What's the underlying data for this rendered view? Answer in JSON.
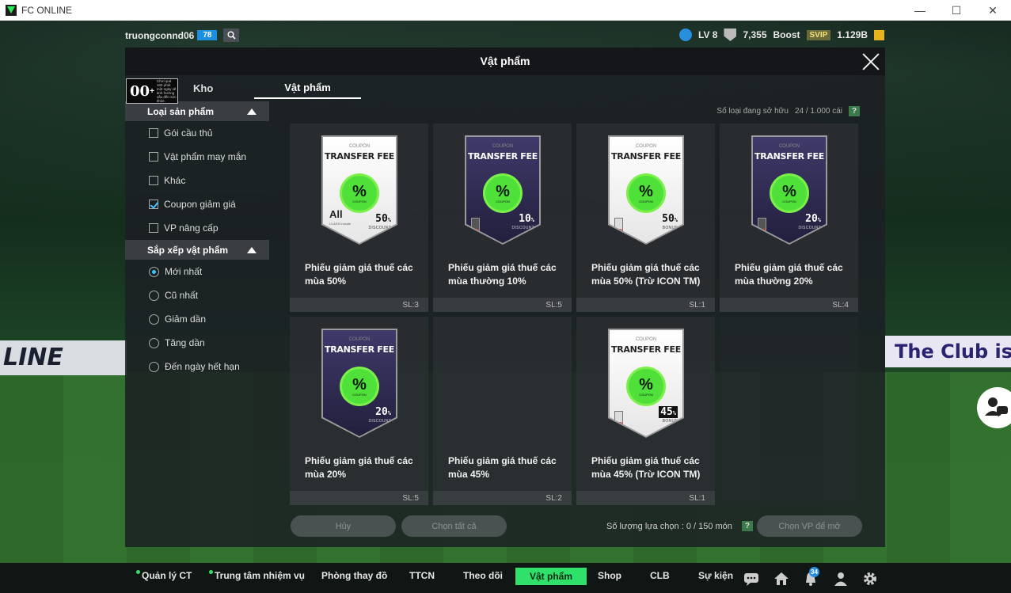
{
  "window": {
    "title": "FC ONLINE",
    "min": "—",
    "max": "☐",
    "close": "✕"
  },
  "background": {
    "ad_left": "LINE",
    "ad_right": "The Club is Y"
  },
  "hud": {
    "username": "truongconnd06",
    "user_level": "78",
    "level": "LV 8",
    "points": "7,355",
    "boost_label": "Boost",
    "svip": "SVIP",
    "coins": "1.129B"
  },
  "panel": {
    "title": "Vật phẩm",
    "tabs": [
      "Kho",
      "Vật phẩm"
    ],
    "age_rating": {
      "value": "00",
      "plus": "+",
      "note": "Chơi quá 180 phút một ngày sẽ ảnh hưởng xấu đến sức khỏe."
    },
    "owned_label": "Số loại đang sở hữu",
    "owned_value": "24 / 1.000 cái",
    "help": "?"
  },
  "sidebar": {
    "category_header": "Loại sản phẩm",
    "categories": [
      {
        "label": "Gói cầu thủ",
        "checked": false
      },
      {
        "label": "Vật phẩm may mắn",
        "checked": false
      },
      {
        "label": "Khác",
        "checked": false
      },
      {
        "label": "Coupon giảm giá",
        "checked": true
      },
      {
        "label": "VP nâng cấp",
        "checked": false
      }
    ],
    "sort_header": "Sắp xếp vật phẩm",
    "sorts": [
      {
        "label": "Mới nhất",
        "selected": true
      },
      {
        "label": "Cũ nhất",
        "selected": false
      },
      {
        "label": "Giảm dần",
        "selected": false
      },
      {
        "label": "Tăng dần",
        "selected": false
      },
      {
        "label": "Đến ngày hết hạn",
        "selected": false
      }
    ]
  },
  "coupon_common": {
    "coupon_word": "COUPON",
    "transfer_fee": "TRANSFER FEE",
    "pct": "%",
    "seal_text": "COUPON"
  },
  "items": [
    {
      "name": "Phiếu giảm giá thuế các mùa 50%",
      "qty": "SL:3",
      "style": "white",
      "value": "50",
      "value_unit": "%",
      "value_sub": "DISCOUNT",
      "all_label": "All",
      "all_sub": "CLASS Include"
    },
    {
      "name": "Phiếu giảm giá thuế các mùa thường 10%",
      "qty": "SL:5",
      "style": "dark",
      "value": "10",
      "value_unit": "%",
      "value_sub": "DISCOUNT"
    },
    {
      "name": "Phiếu giảm giá thuế các mùa 50% (Trừ ICON TM)",
      "qty": "SL:1",
      "style": "white",
      "value": "50",
      "value_unit": "%",
      "value_sub": "BONUS"
    },
    {
      "name": "Phiếu giảm giá thuế các mùa thường 20%",
      "qty": "SL:4",
      "style": "dark",
      "value": "20",
      "value_unit": "%",
      "value_sub": "DISCOUNT"
    },
    {
      "name": "Phiếu giảm giá thuế các mùa 20%",
      "qty": "SL:5",
      "style": "dark",
      "value": "20",
      "value_unit": "%",
      "value_sub": "DISCOUNT"
    },
    {
      "name": "Phiếu giảm giá thuế các mùa 45%",
      "qty": "SL:2",
      "style": "none"
    },
    {
      "name": "Phiếu giảm giá thuế các mùa 45% (Trừ ICON TM)",
      "qty": "SL:1",
      "style": "white",
      "value": "45",
      "value_unit": "%",
      "value_sub": "BONUS"
    }
  ],
  "footer": {
    "cancel": "Hủy",
    "select_all": "Chọn tất cả",
    "select_count_label": "Số lượng lựa chọn : 0 / 150 món",
    "choose_vp": "Chọn VP để mở"
  },
  "nav": {
    "items": [
      {
        "label": "Quản lý CT",
        "dot": true
      },
      {
        "label": "Trung tâm nhiệm vụ",
        "dot": true
      },
      {
        "label": "Phòng thay đồ"
      },
      {
        "label": "TTCN"
      },
      {
        "label": "Theo dõi"
      },
      {
        "label": "Vật phẩm",
        "active": true
      },
      {
        "label": "Shop"
      },
      {
        "label": "CLB"
      },
      {
        "label": "Sự kiện"
      }
    ],
    "notification_count": "34",
    "icons": [
      "chat-icon",
      "home-icon",
      "bell-icon",
      "profile-icon",
      "settings-icon"
    ]
  },
  "colors": {
    "accent_green": "#2fe16a",
    "level_blue": "#1b8fe0",
    "check_blue": "#3ec3ff"
  }
}
